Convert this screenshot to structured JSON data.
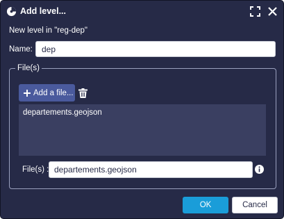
{
  "dialog": {
    "title": "Add level...",
    "subtitle": "New level in \"reg-dep\""
  },
  "name_field": {
    "label": "Name:",
    "value": "dep"
  },
  "files_group": {
    "legend": "File(s)",
    "add_button_label": "Add a file...",
    "list_items": [
      "departements.geojson"
    ],
    "field_label": "File(s) :",
    "field_value": "departements.geojson"
  },
  "buttons": {
    "ok": "OK",
    "cancel": "Cancel"
  },
  "colors": {
    "background": "#262a47",
    "accent": "#1a9dd9",
    "add_button": "#4a5a9d",
    "list_background": "#3a3f61"
  },
  "icons": [
    "app-icon",
    "maximize-icon",
    "close-icon",
    "plus-icon",
    "trash-icon",
    "info-icon"
  ]
}
